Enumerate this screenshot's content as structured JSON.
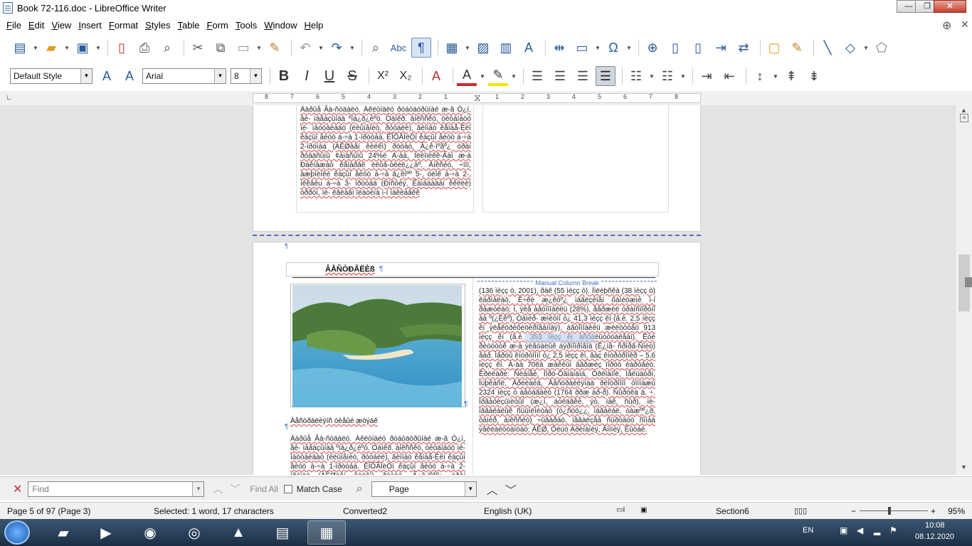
{
  "window": {
    "title": "Book 72-116.doc - LibreOffice Writer",
    "controls": {
      "minimize": "—",
      "maximize": "❐",
      "close": "✕"
    }
  },
  "menubar": [
    "File",
    "Edit",
    "View",
    "Insert",
    "Format",
    "Styles",
    "Table",
    "Form",
    "Tools",
    "Window",
    "Help"
  ],
  "formatting": {
    "paragraph_style": "Default Style",
    "font_name": "Arial",
    "font_size": "8",
    "bold": "B",
    "italic": "I",
    "underline": "U",
    "strike": "S",
    "superscript": "X²",
    "subscript": "X₂",
    "font_color": "#d22a2a",
    "highlight_color": "#f5e60a"
  },
  "ruler": {
    "ticks": [
      "8",
      "7",
      "6",
      "5",
      "4",
      "3",
      "2",
      "1",
      "1",
      "2",
      "3",
      "4",
      "5",
      "6",
      "7",
      "8"
    ]
  },
  "document": {
    "header_text": "ÂÅÑÒÐÅËÈß",
    "column_break_label": "Manual Column Break",
    "caption": "Àåñòðàëèÿíñ òèåûé æóýáê",
    "top_col_text": "Äàðûå Âà-ñòäàëó. Àêëòíäëó ðóáòäòðûíàé æ-â Ò¿í, âè- ìàãàçûíàà ºíá¿ð¿èºò. Òáíêð. áíêññêò, òèòàíàòó ìè- ìàóòàèààò (ëëûìåíèò, ðóòàèè), âèïíàò êåìàå-Êëí êàçûí âèòò á-÷à 1-ïðòóáà. ÊÎÕÃÏëÖí êàçûí âèòò á-÷à 2-íðóìàà (ÀÊØàâí êèëêì) ðóòàò, Â¿ê-ïºãº¿ òðàí ðóàäñûìû ¢àìàñûìû 24%è À-àà, Ìëèìïèêê-Âàì æ-à Ðàêíàæàò êâìàðâê èëòâ-òëèë¿¿àº. Àíêñèò, ÷ïïï, àæþìèíêé êàçûí âèòò á-÷à â¿êìºº 5-, òèìê á-÷à 2-, íêêåëu á-÷à 3- ìðòóáà (Ðìñòèý, Êàìàäàäàí êêëëè) òððóí, íè- êâëàâí ïëàòèíà ì-í ìàêëàâêê",
    "right_col_text": "(136 ìèçç ò, 2001), ðàê (55 ìèçç ò). Ïìëèþñêà (38 ìèçç ò) êàðìàëàò, Ê÷êè æ¿êòº¿ ìáâëçèíâí ôàìèòæìè ì-í ðàæòëàò; Í, ýëâ àâòîìîáëëü (28%), âãðæèë òðàíñïîðòíî àà º(¿Ëêº), Òàìèð- æìèòíí ó¿ 41,3 ìèçç êí (â.è. 2,5 ìèçç êí ýëåêòðèôèöèðîâàííàÿ), àâòîìîáèëü æëëòóòåò 913 ìèçç êí (â.è. 353 ìèçç êí àñôàëüòòòàëãàí). Ëòè ðèòóòòê æ-à ýëâòàëûê áÿðìîïðîâîä (Ê¿ìã- ñðîðâ-Ñìèò) âàð. Ìãðóû êíóðòîííí ó¿ 2,5 ìèçç êí, âàç êìòðòðîìêð – 5,6 ìèçç êí. À-àà 70êà æàêëûí âãðæèç ïîðòó èàðòâèò. Êðèëàðè: Ñèäíåé, Ìîðò-Ôäìàíäìà, Òðëìàìîë, Ìåëüáóðí, Ìüþêàñë, Àðèëàéä, Àâñòðàëèÿíàà ðëîòðîíîì òîïíàæû 2324 ìèçç ò àãòàãàëò (1764 ððæ àð-ð). Ñûðòêà à. ÷. ÌðãàóèçûìèòûÍ (æ¿í, áóëäâêè, ýò, ìàê, ñûð), ìè- ìâãàëàëûê ñûûìëìèòàò (ó¿ñòó¿¿, ìàãàëàë, òàæºº¿ð, òàìèð, áíêññèò) ÷ûãàðàò, ìâãàëçâà ñûðòäòò ñïìàà ýâêëàëòòàïòàò: ÀÊØ, Òëüó Àðèíàíèÿ, Âïïíèÿ, Êûòàé."
  },
  "findbar": {
    "placeholder": "Find",
    "find_all": "Find All",
    "match_case": "Match Case",
    "search_scope": "Page"
  },
  "statusbar": {
    "page": "Page 5 of 97 (Page 3)",
    "selection": "Selected: 1 word, 17 characters",
    "page_style": "Converted2",
    "language": "English (UK)",
    "section": "Section6",
    "zoom": "95%"
  },
  "taskbar": {
    "language": "EN",
    "time": "10:08",
    "date": "08.12.2020"
  }
}
